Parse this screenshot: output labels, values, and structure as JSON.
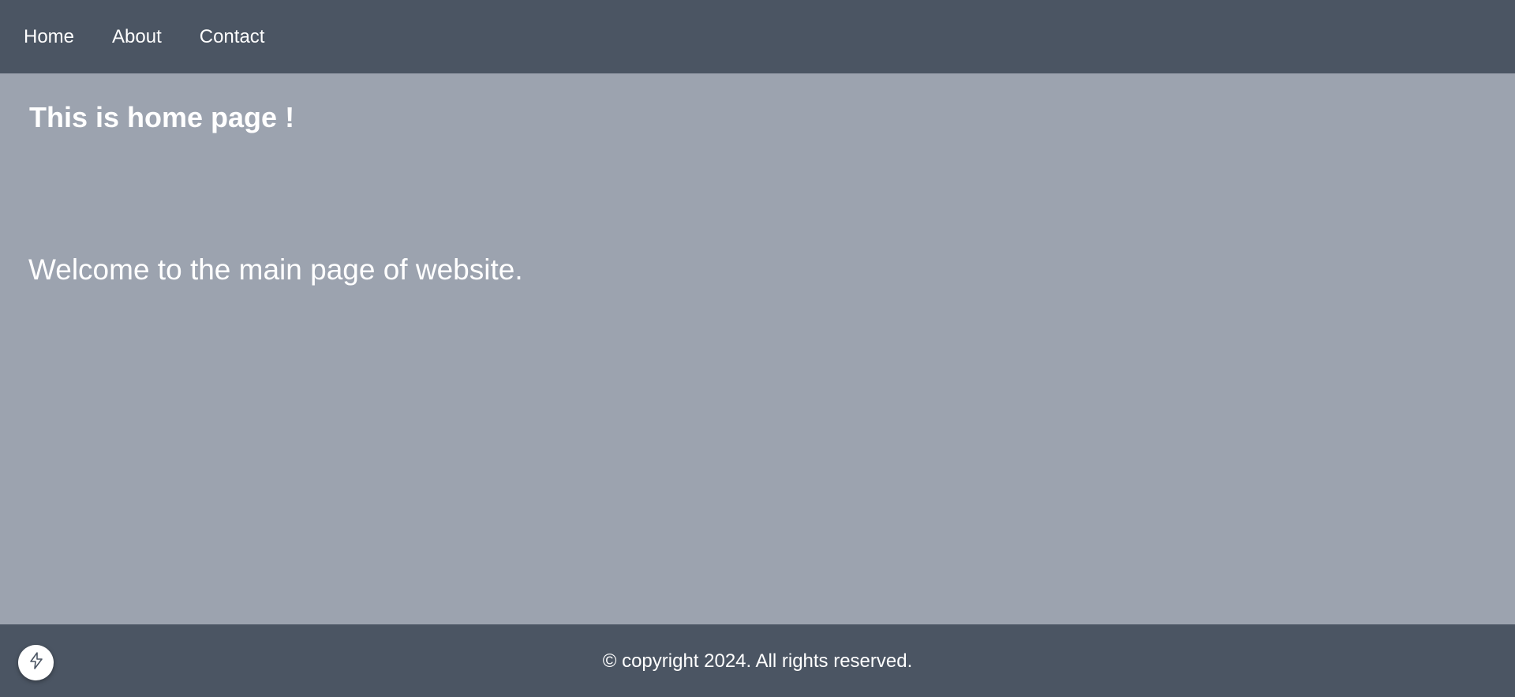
{
  "nav": {
    "items": [
      {
        "label": "Home"
      },
      {
        "label": "About"
      },
      {
        "label": "Contact"
      }
    ]
  },
  "main": {
    "title": "This is home page !",
    "welcome": "Welcome to the main page of website."
  },
  "footer": {
    "copyright": "© copyright 2024. All rights reserved.",
    "fab_icon": "lightning-icon"
  },
  "colors": {
    "header_bg": "#4b5563",
    "main_bg": "#9ca3af",
    "text": "#ffffff"
  }
}
